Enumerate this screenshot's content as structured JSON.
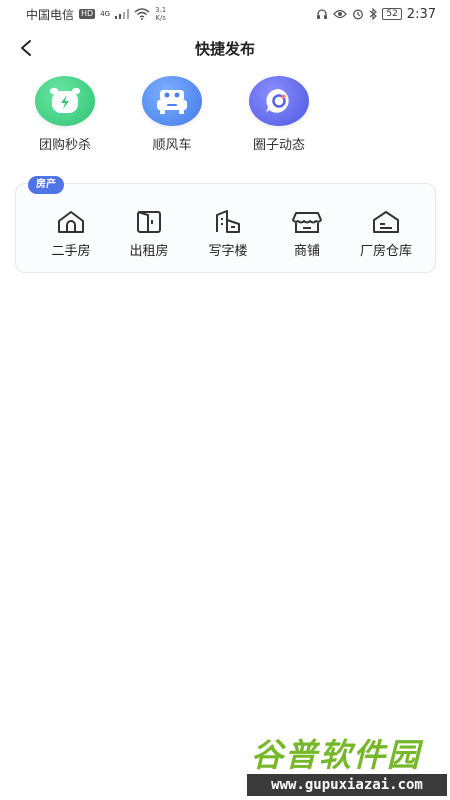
{
  "status_bar": {
    "carrier": "中国电信",
    "hd_badge": "HD",
    "network_type": "4G",
    "speed_value": "3.1",
    "speed_unit": "K/s",
    "battery_level": "52",
    "time": "2:37"
  },
  "header": {
    "title": "快捷发布"
  },
  "quick_actions": [
    {
      "label": "团购秒杀",
      "icon": "alarm-clock-icon",
      "color": "#3ccf7e"
    },
    {
      "label": "顺风车",
      "icon": "car-icon",
      "color": "#4d86ef"
    },
    {
      "label": "圈子动态",
      "icon": "chat-bubble-icon",
      "color": "#5b63e8"
    }
  ],
  "property": {
    "tag": "房产",
    "tag_color": "#4f74e6",
    "items": [
      {
        "label": "二手房",
        "icon": "house-icon"
      },
      {
        "label": "出租房",
        "icon": "door-icon"
      },
      {
        "label": "写字楼",
        "icon": "office-building-icon"
      },
      {
        "label": "商铺",
        "icon": "shop-icon"
      },
      {
        "label": "厂房仓库",
        "icon": "warehouse-icon"
      }
    ]
  },
  "watermark": {
    "brand": "谷普软件园",
    "url": "www.gupuxiazai.com"
  }
}
